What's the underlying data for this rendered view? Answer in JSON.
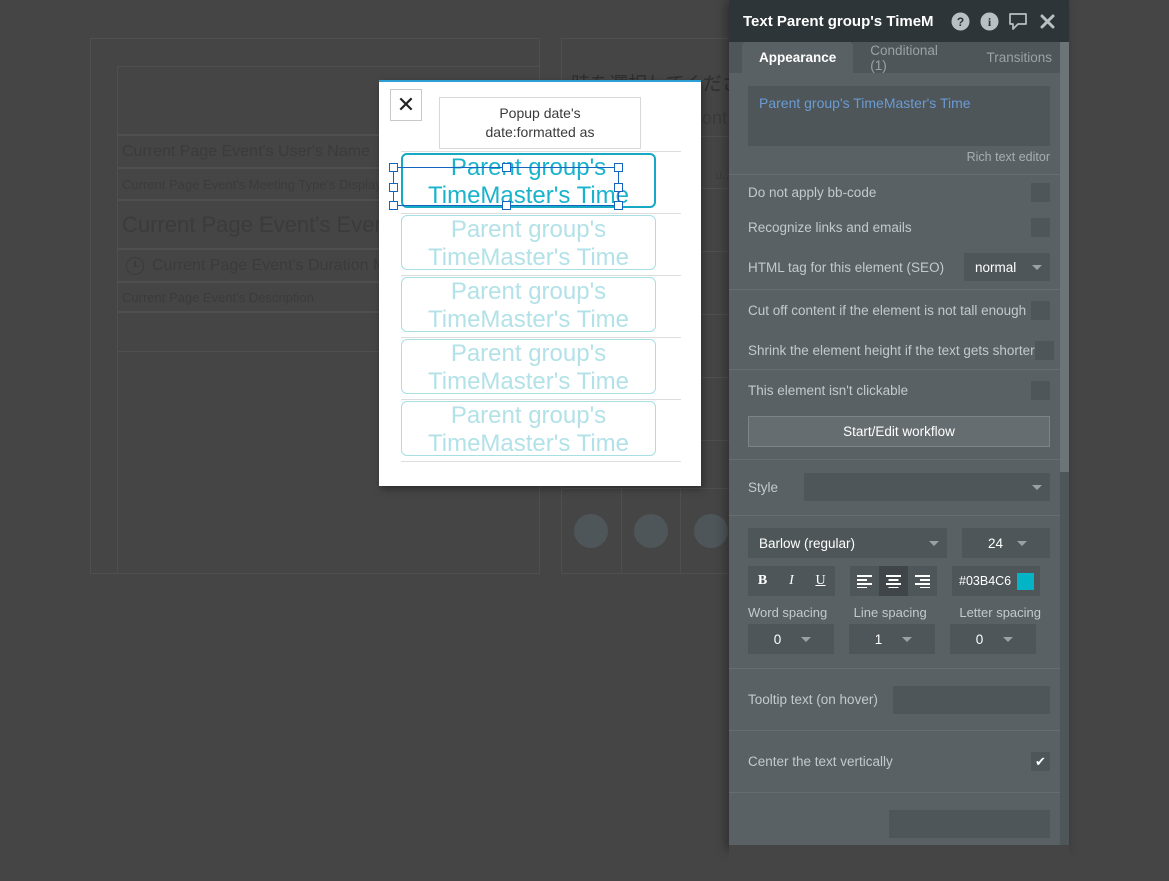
{
  "background": {
    "rows": [
      {
        "id": "blank",
        "text": ""
      },
      {
        "id": "user",
        "text": "Current Page Event's User's Name"
      },
      {
        "id": "meeting",
        "text": "Current Page Event's Meeting Type's Display"
      },
      {
        "id": "title",
        "text": "Current Page Event's Even"
      },
      {
        "id": "duration",
        "text": "Current Page Event's Duration Min"
      },
      {
        "id": "desc",
        "text": "Current Page Event's Description"
      },
      {
        "id": "tail",
        "text": ""
      }
    ],
    "right_column": {
      "jp_title": "日時を選択してください",
      "font_label": "ont",
      "truncated": "u..."
    }
  },
  "popup": {
    "close_label": "✕",
    "date_label_line1": "Popup date's",
    "date_label_line2": "date:formatted as",
    "slots": [
      {
        "text": "Parent group's TimeMaster's Time",
        "selected": true
      },
      {
        "text": "Parent group's TimeMaster's Time",
        "selected": false
      },
      {
        "text": "Parent group's TimeMaster's Time",
        "selected": false
      },
      {
        "text": "Parent group's TimeMaster's Time",
        "selected": false
      },
      {
        "text": "Parent group's TimeMaster's Time",
        "selected": false
      }
    ]
  },
  "panel": {
    "title": "Text Parent group's TimeM",
    "header_icons": [
      "help-icon",
      "info-icon",
      "comment-icon",
      "close-icon"
    ],
    "tabs": [
      {
        "label": "Appearance",
        "active": true
      },
      {
        "label": "Conditional (1)",
        "active": false
      },
      {
        "label": "Transitions",
        "active": false
      }
    ],
    "rich_text": {
      "value": "Parent group's TimeMaster's Time",
      "caption": "Rich text editor"
    },
    "options": [
      {
        "label": "Do not apply bb-code",
        "checked": false
      },
      {
        "label": "Recognize links and emails",
        "checked": false
      }
    ],
    "seo": {
      "label": "HTML tag for this element (SEO)",
      "value": "normal"
    },
    "layout_options": [
      {
        "label": "Cut off content if the element is not tall enough",
        "checked": false
      },
      {
        "label": "Shrink the element height if the text gets shorter",
        "checked": false
      }
    ],
    "clickable": {
      "label": "This element isn't clickable",
      "checked": false,
      "workflow_button": "Start/Edit workflow"
    },
    "style": {
      "label": "Style",
      "value": ""
    },
    "font": {
      "family": "Barlow (regular)",
      "size": "24",
      "bold_label": "B",
      "italic_label": "I",
      "underline_label": "U",
      "align": "center",
      "color_hex": "#03B4C6",
      "color_swatch": "#03B4C6"
    },
    "spacing": {
      "word_label": "Word spacing",
      "word_value": "0",
      "line_label": "Line spacing",
      "line_value": "1",
      "letter_label": "Letter spacing",
      "letter_value": "0"
    },
    "tooltip": {
      "label": "Tooltip text (on hover)",
      "value": ""
    },
    "center_vertically": {
      "label": "Center the text vertically",
      "checked": true,
      "check_glyph": "✔"
    },
    "partial_bottom": {
      "label": "",
      "value": ""
    }
  }
}
